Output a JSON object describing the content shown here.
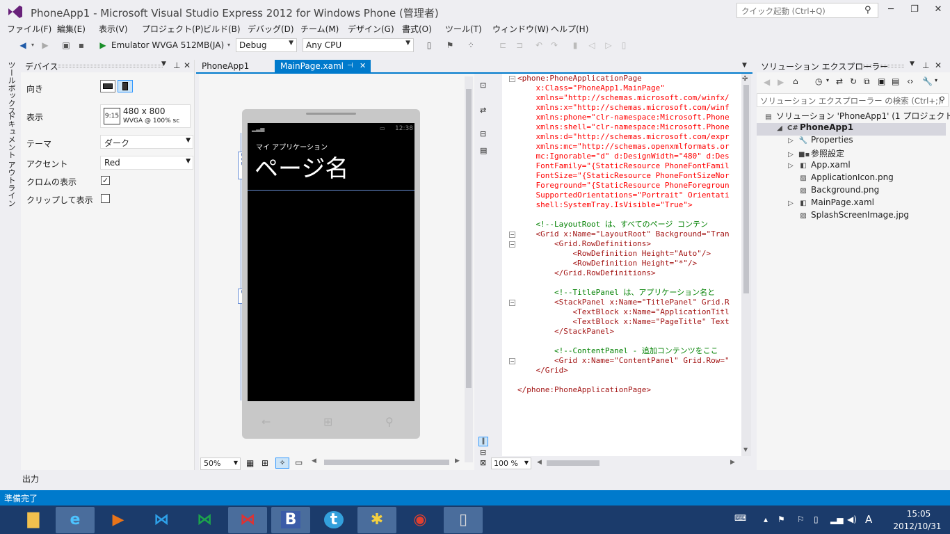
{
  "window": {
    "title": "PhoneApp1 - Microsoft Visual Studio Express 2012 for Windows Phone (管理者)",
    "quick_launch_placeholder": "クイック起動 (Ctrl+Q)"
  },
  "menu": [
    "ファイル(F)",
    "編集(E)",
    "表示(V)",
    "プロジェクト(P)",
    "ビルド(B)",
    "デバッグ(D)",
    "チーム(M)",
    "デザイン(G)",
    "書式(O)",
    "ツール(T)",
    "ウィンドウ(W)",
    "ヘルプ(H)"
  ],
  "toolbar": {
    "run_target": "Emulator WVGA 512MB(JA)",
    "config": "Debug",
    "platform": "Any CPU"
  },
  "left_tabs": [
    "ツールボックス",
    "ドキュメント アウトライン"
  ],
  "device_panel": {
    "title": "デバイス",
    "orientation_label": "向き",
    "display_label": "表示",
    "display_value": "480 x 800",
    "display_sub": "WVGA @ 100% sc",
    "display_icon": "9:15",
    "theme_label": "テーマ",
    "theme_value": "ダーク",
    "accent_label": "アクセント",
    "accent_value": "Red",
    "chrome_label": "クロムの表示",
    "chrome_checked": true,
    "clip_label": "クリップして表示",
    "clip_checked": false
  },
  "tabs": {
    "first": "PhoneApp1",
    "active": "MainPage.xaml"
  },
  "designer": {
    "app_name": "マイ アプリケーション",
    "page_title": "ページ名",
    "status_time": "12:38",
    "row_height_1": "161",
    "row_height_2": "1*",
    "zoom": "50%"
  },
  "xml_zoom": "100 %",
  "xml_lines": [
    {
      "t": "<phone:PhoneApplicationPage",
      "c": "#a31515"
    },
    {
      "t": "    x:Class=\"PhoneApp1.MainPage\"",
      "c": "#ff0000"
    },
    {
      "t": "    xmlns=\"http://schemas.microsoft.com/winfx/",
      "c": "#ff0000"
    },
    {
      "t": "    xmlns:x=\"http://schemas.microsoft.com/winf",
      "c": "#ff0000"
    },
    {
      "t": "    xmlns:phone=\"clr-namespace:Microsoft.Phone",
      "c": "#ff0000"
    },
    {
      "t": "    xmlns:shell=\"clr-namespace:Microsoft.Phone",
      "c": "#ff0000"
    },
    {
      "t": "    xmlns:d=\"http://schemas.microsoft.com/expr",
      "c": "#ff0000"
    },
    {
      "t": "    xmlns:mc=\"http://schemas.openxmlformats.or",
      "c": "#ff0000"
    },
    {
      "t": "    mc:Ignorable=\"d\" d:DesignWidth=\"480\" d:Des",
      "c": "#ff0000"
    },
    {
      "t": "    FontFamily=\"{StaticResource PhoneFontFamil",
      "c": "#ff0000"
    },
    {
      "t": "    FontSize=\"{StaticResource PhoneFontSizeNor",
      "c": "#ff0000"
    },
    {
      "t": "    Foreground=\"{StaticResource PhoneForegroun",
      "c": "#ff0000"
    },
    {
      "t": "    SupportedOrientations=\"Portrait\" Orientati",
      "c": "#ff0000"
    },
    {
      "t": "    shell:SystemTray.IsVisible=\"True\">",
      "c": "#ff0000"
    },
    {
      "t": "",
      "c": "#000"
    },
    {
      "t": "    <!--LayoutRoot は、すべてのページ コンテン",
      "c": "#008000"
    },
    {
      "t": "    <Grid x:Name=\"LayoutRoot\" Background=\"Tran",
      "c": "#a31515"
    },
    {
      "t": "        <Grid.RowDefinitions>",
      "c": "#a31515"
    },
    {
      "t": "            <RowDefinition Height=\"Auto\"/>",
      "c": "#a31515"
    },
    {
      "t": "            <RowDefinition Height=\"*\"/>",
      "c": "#a31515"
    },
    {
      "t": "        </Grid.RowDefinitions>",
      "c": "#a31515"
    },
    {
      "t": "",
      "c": "#000"
    },
    {
      "t": "        <!--TitlePanel は、アプリケーション名と",
      "c": "#008000"
    },
    {
      "t": "        <StackPanel x:Name=\"TitlePanel\" Grid.R",
      "c": "#a31515"
    },
    {
      "t": "            <TextBlock x:Name=\"ApplicationTitl",
      "c": "#a31515"
    },
    {
      "t": "            <TextBlock x:Name=\"PageTitle\" Text",
      "c": "#a31515"
    },
    {
      "t": "        </StackPanel>",
      "c": "#a31515"
    },
    {
      "t": "",
      "c": "#000"
    },
    {
      "t": "        <!--ContentPanel - 追加コンテンツをここ",
      "c": "#008000"
    },
    {
      "t": "        <Grid x:Name=\"ContentPanel\" Grid.Row=\"",
      "c": "#a31515"
    },
    {
      "t": "    </Grid>",
      "c": "#a31515"
    },
    {
      "t": "",
      "c": "#000"
    },
    {
      "t": "</phone:PhoneApplicationPage>",
      "c": "#a31515"
    }
  ],
  "solution_explorer": {
    "title": "ソリューション エクスプローラー",
    "search_placeholder": "ソリューション エクスプローラー の検索 (Ctrl+;)",
    "items": [
      {
        "label": "ソリューション 'PhoneApp1' (1 プロジェクト)",
        "icon": "solution",
        "level": 0,
        "expander": ""
      },
      {
        "label": "PhoneApp1",
        "icon": "csharp-project",
        "level": 1,
        "expander": "◢",
        "bold": true
      },
      {
        "label": "Properties",
        "icon": "wrench",
        "level": 2,
        "expander": "▷"
      },
      {
        "label": "参照設定",
        "icon": "references",
        "level": 2,
        "expander": "▷"
      },
      {
        "label": "App.xaml",
        "icon": "xaml-file",
        "level": 2,
        "expander": "▷"
      },
      {
        "label": "ApplicationIcon.png",
        "icon": "image-file",
        "level": 2,
        "expander": ""
      },
      {
        "label": "Background.png",
        "icon": "image-file",
        "level": 2,
        "expander": ""
      },
      {
        "label": "MainPage.xaml",
        "icon": "xaml-file",
        "level": 2,
        "expander": "▷"
      },
      {
        "label": "SplashScreenImage.jpg",
        "icon": "image-file",
        "level": 2,
        "expander": ""
      }
    ]
  },
  "output_label": "出力",
  "status": "準備完了",
  "taskbar": {
    "time": "15:05",
    "date": "2012/10/31",
    "ime": "A"
  },
  "colors": {
    "accent": "#007acc",
    "taskbar": "#1b3b6b"
  }
}
